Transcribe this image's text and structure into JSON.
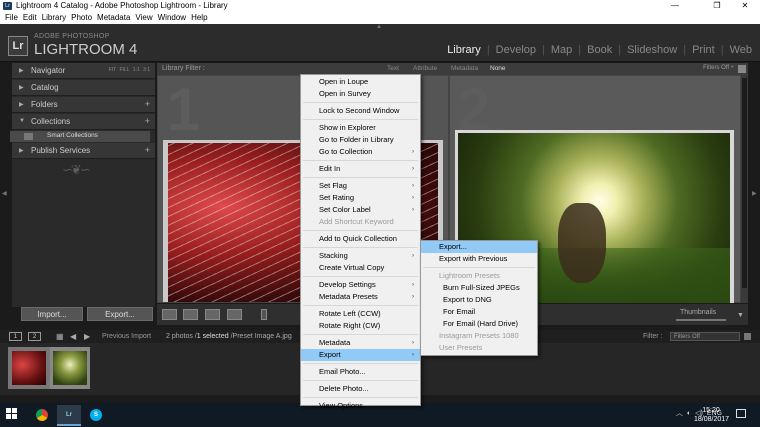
{
  "window": {
    "title": "Lightroom 4 Catalog - Adobe Photoshop Lightroom - Library",
    "minimize": "—",
    "maximize": "❐",
    "close": "✕"
  },
  "menubar": [
    "File",
    "Edit",
    "Library",
    "Photo",
    "Metadata",
    "View",
    "Window",
    "Help"
  ],
  "brand": {
    "logo": "Lr",
    "sub": "ADOBE PHOTOSHOP",
    "main": "LIGHTROOM 4"
  },
  "modules": [
    "Library",
    "Develop",
    "Map",
    "Book",
    "Slideshow",
    "Print",
    "Web"
  ],
  "active_module": "Library",
  "left_panel": {
    "navigator": "Navigator",
    "zoom_options": "FIT  FILL  1:1  3:1",
    "catalog": "Catalog",
    "folders": "Folders",
    "collections": "Collections",
    "smart_collections": "Smart Collections",
    "publish_services": "Publish Services",
    "import_button": "Import...",
    "export_button": "Export..."
  },
  "filter_bar": {
    "label": "Library Filter :",
    "options": [
      "Text",
      "Attribute",
      "Metadata",
      "None"
    ],
    "selected": "None",
    "filters_off": "Filters Off ÷"
  },
  "grid": {
    "cell_numbers": [
      "1",
      "2"
    ]
  },
  "toolbar": {
    "thumbnails_label": "Thumbnails"
  },
  "filmstrip": {
    "screen1": "1",
    "screen2": "2",
    "previous_import": "Previous Import",
    "count_prefix": "2 photos /",
    "count_selected": "1 selected",
    "count_suffix": " /Preset Image A.jpg",
    "filter_label": "Filter :",
    "filter_value": "Filters Off"
  },
  "context_menu": {
    "items": [
      {
        "label": "Open in Loupe",
        "submenu": false,
        "disabled": false
      },
      {
        "label": "Open in Survey",
        "submenu": false,
        "disabled": false
      },
      {
        "separator": true
      },
      {
        "label": "Lock to Second Window",
        "submenu": false,
        "disabled": false
      },
      {
        "separator": true
      },
      {
        "label": "Show in Explorer",
        "submenu": false,
        "disabled": false
      },
      {
        "label": "Go to Folder in Library",
        "submenu": false,
        "disabled": false
      },
      {
        "label": "Go to Collection",
        "submenu": true,
        "disabled": false
      },
      {
        "separator": true
      },
      {
        "label": "Edit In",
        "submenu": true,
        "disabled": false
      },
      {
        "separator": true
      },
      {
        "label": "Set Flag",
        "submenu": true,
        "disabled": false
      },
      {
        "label": "Set Rating",
        "submenu": true,
        "disabled": false
      },
      {
        "label": "Set Color Label",
        "submenu": true,
        "disabled": false
      },
      {
        "label": "Add Shortcut Keyword",
        "submenu": false,
        "disabled": true
      },
      {
        "separator": true
      },
      {
        "label": "Add to Quick Collection",
        "submenu": false,
        "disabled": false
      },
      {
        "separator": true
      },
      {
        "label": "Stacking",
        "submenu": true,
        "disabled": false
      },
      {
        "label": "Create Virtual Copy",
        "submenu": false,
        "disabled": false
      },
      {
        "separator": true
      },
      {
        "label": "Develop Settings",
        "submenu": true,
        "disabled": false
      },
      {
        "label": "Metadata Presets",
        "submenu": true,
        "disabled": false
      },
      {
        "separator": true
      },
      {
        "label": "Rotate Left (CCW)",
        "submenu": false,
        "disabled": false
      },
      {
        "label": "Rotate Right (CW)",
        "submenu": false,
        "disabled": false
      },
      {
        "separator": true
      },
      {
        "label": "Metadata",
        "submenu": true,
        "disabled": false
      },
      {
        "label": "Export",
        "submenu": true,
        "disabled": false,
        "highlighted": true
      },
      {
        "separator": true
      },
      {
        "label": "Email Photo...",
        "submenu": false,
        "disabled": false
      },
      {
        "separator": true
      },
      {
        "label": "Delete Photo...",
        "submenu": false,
        "disabled": false
      },
      {
        "separator": true
      },
      {
        "label": "View Options...",
        "submenu": false,
        "disabled": false
      }
    ]
  },
  "export_submenu": {
    "items": [
      {
        "label": "Export...",
        "indent": false,
        "disabled": false,
        "highlighted": true
      },
      {
        "label": "Export with Previous",
        "indent": false,
        "disabled": false
      },
      {
        "separator": true
      },
      {
        "label": "Lightroom Presets",
        "indent": false,
        "disabled": true
      },
      {
        "label": "Burn Full-Sized JPEGs",
        "indent": true,
        "disabled": false
      },
      {
        "label": "Export to DNG",
        "indent": true,
        "disabled": false
      },
      {
        "label": "For Email",
        "indent": true,
        "disabled": false
      },
      {
        "label": "For Email (Hard Drive)",
        "indent": true,
        "disabled": false
      },
      {
        "label": "Instagram Presets 1080",
        "indent": false,
        "disabled": true
      },
      {
        "label": "User Presets",
        "indent": false,
        "disabled": true
      }
    ]
  },
  "taskbar": {
    "tray_lang": "ENG",
    "time": "15:20",
    "date": "18/08/2017"
  },
  "colors": {
    "menu_highlight": "#91c9f7",
    "panel_bg": "#2a2a2a",
    "grid_bg": "#4b4b4b"
  }
}
